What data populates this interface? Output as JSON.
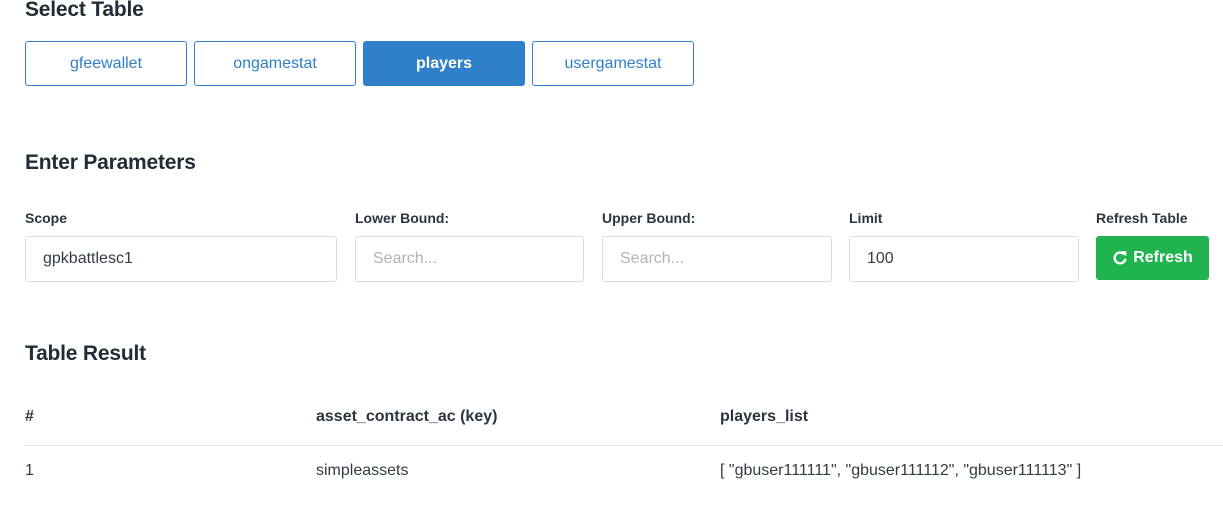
{
  "select_table": {
    "title": "Select Table",
    "tabs": [
      {
        "label": "gfeewallet",
        "active": false
      },
      {
        "label": "ongamestat",
        "active": false
      },
      {
        "label": "players",
        "active": true
      },
      {
        "label": "usergamestat",
        "active": false
      }
    ]
  },
  "parameters": {
    "title": "Enter Parameters",
    "scope": {
      "label": "Scope",
      "value": "gpkbattlesc1",
      "placeholder": ""
    },
    "lower_bound": {
      "label": "Lower Bound:",
      "value": "",
      "placeholder": "Search..."
    },
    "upper_bound": {
      "label": "Upper Bound:",
      "value": "",
      "placeholder": "Search..."
    },
    "limit": {
      "label": "Limit",
      "value": "100",
      "placeholder": ""
    },
    "refresh": {
      "label": "Refresh Table",
      "button_label": "Refresh",
      "icon": "refresh-icon"
    }
  },
  "result": {
    "title": "Table Result",
    "columns": [
      "#",
      "asset_contract_ac (key)",
      "players_list"
    ],
    "rows": [
      [
        "1",
        "simpleassets",
        "[ \"gbuser111111\", \"gbuser111112\", \"gbuser111113\" ]"
      ]
    ]
  },
  "colors": {
    "primary": "#2f80c8",
    "success": "#21b34f",
    "heading": "#222c37"
  }
}
